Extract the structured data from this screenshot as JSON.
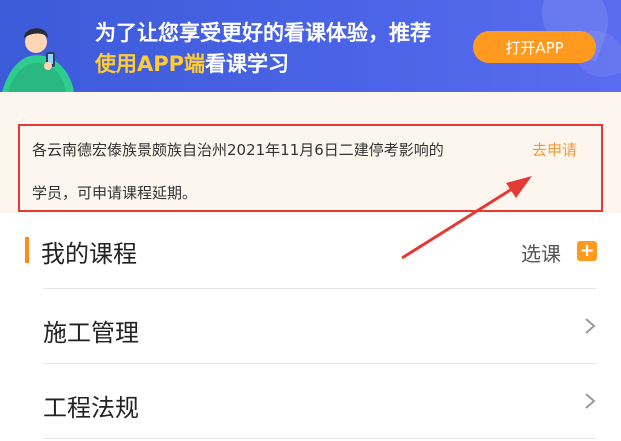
{
  "banner": {
    "line1": "为了让您享受更好的看课体验，推荐",
    "line2_highlight": "使用APP端",
    "line2_rest": "看课学习",
    "open_app_label": "打开APP",
    "colors": {
      "background": "#4a63e6",
      "highlight": "#ffcc33",
      "button": "#ff9a1f"
    }
  },
  "notice": {
    "line1": "各云南德宏傣族景颇族自治州2021年11月6日二建停考影响的",
    "apply_link": "去申请",
    "line2": "学员，可申请课程延期。",
    "colors": {
      "border": "#e53935",
      "link": "#f29b38",
      "background": "#fdf6ee"
    }
  },
  "section": {
    "title": "我的课程",
    "choose_label": "选课",
    "plus_symbol": "+",
    "colors": {
      "accent": "#ff8c1a"
    }
  },
  "courses": [
    {
      "name": "施工管理"
    },
    {
      "name": "工程法规"
    }
  ],
  "icons": {
    "banner_figure": "student-with-phone-illustration",
    "row_chevron": "chevron-right-icon",
    "add": "plus-square-icon"
  },
  "annotation": {
    "arrow_color": "#e53935"
  }
}
